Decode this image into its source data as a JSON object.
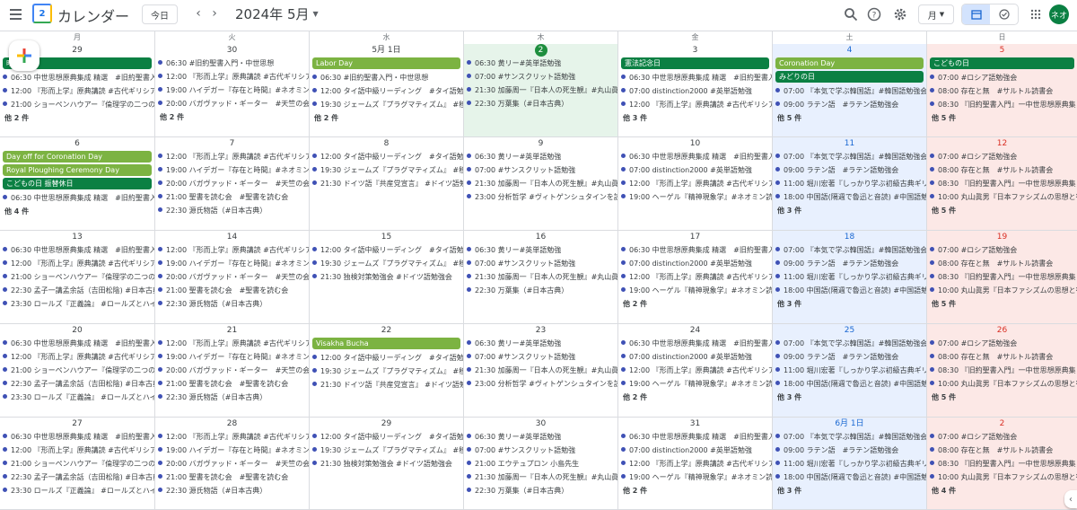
{
  "app": {
    "title": "カレンダー",
    "logo_num": "2"
  },
  "toolbar": {
    "today": "今日",
    "prev": "‹",
    "next": "›",
    "month_label": "2024年 5月",
    "view": "月",
    "avatar": "ネオ"
  },
  "colors": {
    "event_dot": "#3f51b5",
    "holiday_green": "#7cb342",
    "holiday_dark": "#0b8043",
    "today_bg": "#e6f4ea",
    "sat_bg": "#e8f0fe",
    "sun_bg": "#fce8e6"
  },
  "weekdays": [
    "月",
    "火",
    "水",
    "木",
    "金",
    "土",
    "日"
  ],
  "weeks": [
    [
      {
        "day": "29",
        "allday": [
          {
            "label": "昭和の日",
            "style": "dark"
          }
        ],
        "events": [
          "06:30 中世思想原典集成 精選　#旧約聖書入",
          "12:00 『形而上学』原典講読 #古代ギリシア",
          "21:00 ショーペンハウアー『倫理学の二つの"
        ],
        "more": "他 2 件"
      },
      {
        "day": "30",
        "allday": [],
        "events": [
          "06:30 #旧約聖書入門・中世思想",
          "12:00 『形而上学』原典講読 #古代ギリシア",
          "19:00 ハイデガー『存在と時間』#ネオミン",
          "20:00 バガヴァッド・ギーター　#天竺の会"
        ],
        "more": "他 2 件"
      },
      {
        "day": "5月 1日",
        "allday": [
          {
            "label": "Labor Day",
            "style": "green"
          }
        ],
        "events": [
          "06:30 #旧約聖書入門・中世思想",
          "12:00 タイ語中級リーディング　#タイ語勉",
          "19:30 ジェームズ『プラグマティズム』 #移"
        ],
        "more": "他 2 件"
      },
      {
        "day": "2",
        "today": true,
        "allday": [],
        "events": [
          "06:30 黄リー#英単語勉強",
          "07:00 #サンスクリット語勉強",
          "21:30 加藤周一『日本人の死生観』#丸山眞",
          "22:30 万葉集（#日本古典）"
        ],
        "more": ""
      },
      {
        "day": "3",
        "allday": [
          {
            "label": "憲法記念日",
            "style": "dark"
          }
        ],
        "events": [
          "06:30 中世思想原典集成 精選　#旧約聖書入",
          "07:00 distinction2000 #英単語勉強",
          "12:00 『形而上学』原典講読 #古代ギリシア"
        ],
        "more": "他 3 件"
      },
      {
        "day": "4",
        "allday": [
          {
            "label": "Coronation Day",
            "style": "green"
          },
          {
            "label": "みどりの日",
            "style": "dark"
          }
        ],
        "events": [
          "07:00 『本気で学ぶ韓国語』#韓国語勉強会",
          "09:00 ラテン語　#ラテン語勉強会"
        ],
        "more": "他 5 件"
      },
      {
        "day": "5",
        "allday": [
          {
            "label": "こどもの日",
            "style": "dark"
          }
        ],
        "events": [
          "07:00 #ロシア語勉強会",
          "08:00 存在と無　#サルトル読書会",
          "08:30 『旧約聖書入門』一中世思想原典集"
        ],
        "more": "他 5 件"
      }
    ],
    [
      {
        "day": "6",
        "allday": [
          {
            "label": "Day off for Coronation Day",
            "style": "green"
          },
          {
            "label": "Royal Ploughing Ceremony Day",
            "style": "green"
          },
          {
            "label": "こどもの日 振替休日",
            "style": "dark"
          }
        ],
        "events": [
          "06:30 中世思想原典集成 精選　#旧約聖書入"
        ],
        "more": "他 4 件"
      },
      {
        "day": "7",
        "allday": [],
        "events": [
          "12:00 『形而上学』原典講読 #古代ギリシア",
          "19:00 ハイデガー『存在と時間』#ネオミン",
          "20:00 バガヴァッド・ギーター　#天竺の会",
          "21:00 聖書を読む会　#聖書を読む会",
          "22:30 源氏物語（#日本古典）"
        ],
        "more": ""
      },
      {
        "day": "8",
        "allday": [],
        "events": [
          "12:00 タイ語中級リーディング　#タイ語勉",
          "19:30 ジェームズ『プラグマティズム』 #移",
          "21:30 ドイツ語『共産党宣言』 #ドイツ語勉"
        ],
        "more": ""
      },
      {
        "day": "9",
        "allday": [],
        "events": [
          "06:30 黄リー#英単語勉強",
          "07:00 #サンスクリット語勉強",
          "21:30 加藤周一『日本人の死生観』#丸山眞",
          "23:00 分析哲学 #ヴィトゲンシュタインを読"
        ],
        "more": ""
      },
      {
        "day": "10",
        "allday": [],
        "events": [
          "06:30 中世思想原典集成 精選　#旧約聖書入",
          "07:00 distinction2000 #英単語勉強",
          "12:00 『形而上学』原典講読 #古代ギリシア",
          "19:00 ヘーゲル『精神現象学』#ネオミン読"
        ],
        "more": ""
      },
      {
        "day": "11",
        "allday": [],
        "events": [
          "07:00 『本気で学ぶ韓国語』#韓国語勉強会",
          "09:00 ラテン語　#ラテン語勉強会",
          "11:00 堀川宏著『しっかり学ぶ初級古典ギリ",
          "18:00 中国語(隔週で魯迅と音読) #中国語勉"
        ],
        "more": "他 3 件"
      },
      {
        "day": "12",
        "allday": [],
        "events": [
          "07:00 #ロシア語勉強会",
          "08:00 存在と無　#サルトル読書会",
          "08:30 『旧約聖書入門』一中世思想原典集",
          "10:00 丸山眞男『日本ファシズムの思想と行"
        ],
        "more": "他 5 件"
      }
    ],
    [
      {
        "day": "13",
        "allday": [],
        "events": [
          "06:30 中世思想原典集成 精選　#旧約聖書入",
          "12:00 『形而上学』原典講読 #古代ギリシア",
          "21:00 ショーペンハウアー『倫理学の二つの",
          "22:30 孟子一講孟余話（吉田松陰) #日本古典",
          "23:30 ロールズ『正義論』 #ロールズとハイ"
        ],
        "more": ""
      },
      {
        "day": "14",
        "allday": [],
        "events": [
          "12:00 『形而上学』原典講読 #古代ギリシア",
          "19:00 ハイデガー『存在と時間』#ネオミン",
          "20:00 バガヴァッド・ギーター　#天竺の会",
          "21:00 聖書を読む会　#聖書を読む会",
          "22:30 源氏物語（#日本古典）"
        ],
        "more": ""
      },
      {
        "day": "15",
        "allday": [],
        "events": [
          "12:00 タイ語中級リーディング　#タイ語勉",
          "19:30 ジェームズ『プラグマティズム』 #移",
          "21:30 独検対策勉強会 #ドイツ語勉強会"
        ],
        "more": ""
      },
      {
        "day": "16",
        "allday": [],
        "events": [
          "06:30 黄リー#英単語勉強",
          "07:00 #サンスクリット語勉強",
          "21:30 加藤周一『日本人の死生観』#丸山眞",
          "22:30 万葉集（#日本古典）"
        ],
        "more": ""
      },
      {
        "day": "17",
        "allday": [],
        "events": [
          "06:30 中世思想原典集成 精選　#旧約聖書入",
          "07:00 distinction2000 #英単語勉強",
          "12:00 『形而上学』原典講読 #古代ギリシア",
          "19:00 ヘーゲル『精神現象学』#ネオミン読"
        ],
        "more": "他 2 件"
      },
      {
        "day": "18",
        "allday": [],
        "events": [
          "07:00 『本気で学ぶ韓国語』#韓国語勉強会",
          "09:00 ラテン語　#ラテン語勉強会",
          "11:00 堀川宏著『しっかり学ぶ初級古典ギリ",
          "18:00 中国語(隔週で魯迅と音読) #中国語勉"
        ],
        "more": "他 3 件"
      },
      {
        "day": "19",
        "allday": [],
        "events": [
          "07:00 #ロシア語勉強会",
          "08:00 存在と無　#サルトル読書会",
          "08:30 『旧約聖書入門』一中世思想原典集",
          "10:00 丸山眞男『日本ファシズムの思想と行"
        ],
        "more": "他 5 件"
      }
    ],
    [
      {
        "day": "20",
        "allday": [],
        "events": [
          "06:30 中世思想原典集成 精選　#旧約聖書入",
          "12:00 『形而上学』原典講読 #古代ギリシア",
          "21:00 ショーペンハウアー『倫理学の二つの",
          "22:30 孟子一講孟余話（吉田松陰) #日本古典",
          "23:30 ロールズ『正義論』 #ロールズとハイ"
        ],
        "more": ""
      },
      {
        "day": "21",
        "allday": [],
        "events": [
          "12:00 『形而上学』原典講読 #古代ギリシア",
          "19:00 ハイデガー『存在と時間』#ネオミン",
          "20:00 バガヴァッド・ギーター　#天竺の会",
          "21:00 聖書を読む会　#聖書を読む会",
          "22:30 源氏物語（#日本古典）"
        ],
        "more": ""
      },
      {
        "day": "22",
        "allday": [
          {
            "label": "Visakha Bucha",
            "style": "green"
          }
        ],
        "events": [
          "12:00 タイ語中級リーディング　#タイ語勉",
          "19:30 ジェームズ『プラグマティズム』 #移",
          "21:30 ドイツ語『共産党宣言』 #ドイツ語勉"
        ],
        "more": ""
      },
      {
        "day": "23",
        "allday": [],
        "events": [
          "06:30 黄リー#英単語勉強",
          "07:00 #サンスクリット語勉強",
          "21:30 加藤周一『日本人の死生観』#丸山眞",
          "23:00 分析哲学 #ヴィトゲンシュタインを読"
        ],
        "more": ""
      },
      {
        "day": "24",
        "allday": [],
        "events": [
          "06:30 中世思想原典集成 精選　#旧約聖書入",
          "07:00 distinction2000 #英単語勉強",
          "12:00 『形而上学』原典講読 #古代ギリシア",
          "19:00 ヘーゲル『精神現象学』#ネオミン読"
        ],
        "more": "他 2 件"
      },
      {
        "day": "25",
        "allday": [],
        "events": [
          "07:00 『本気で学ぶ韓国語』#韓国語勉強会",
          "09:00 ラテン語　#ラテン語勉強会",
          "11:00 堀川宏著『しっかり学ぶ初級古典ギリ",
          "18:00 中国語(隔週で魯迅と音読) #中国語勉"
        ],
        "more": "他 3 件"
      },
      {
        "day": "26",
        "allday": [],
        "events": [
          "07:00 #ロシア語勉強会",
          "08:00 存在と無　#サルトル読書会",
          "08:30 『旧約聖書入門』一中世思想原典集",
          "10:00 丸山眞男『日本ファシズムの思想と行"
        ],
        "more": "他 5 件"
      }
    ],
    [
      {
        "day": "27",
        "allday": [],
        "events": [
          "06:30 中世思想原典集成 精選　#旧約聖書入",
          "12:00 『形而上学』原典講読 #古代ギリシア",
          "21:00 ショーペンハウアー『倫理学の二つの",
          "22:30 孟子一講孟余話（吉田松陰) #日本古典",
          "23:30 ロールズ『正義論』 #ロールズとハイ"
        ],
        "more": ""
      },
      {
        "day": "28",
        "allday": [],
        "events": [
          "12:00 『形而上学』原典講読 #古代ギリシア",
          "19:00 ハイデガー『存在と時間』#ネオミン",
          "20:00 バガヴァッド・ギーター　#天竺の会",
          "21:00 聖書を読む会　#聖書を読む会",
          "22:30 源氏物語（#日本古典）"
        ],
        "more": ""
      },
      {
        "day": "29",
        "allday": [],
        "events": [
          "12:00 タイ語中級リーディング　#タイ語勉",
          "19:30 ジェームズ『プラグマティズム』 #移",
          "21:30 独検対策勉強会 #ドイツ語勉強会"
        ],
        "more": ""
      },
      {
        "day": "30",
        "allday": [],
        "events": [
          "06:30 黄リー#英単語勉強",
          "07:00 #サンスクリット語勉強",
          "21:00 エウテュプロン 小島先生",
          "21:30 加藤周一『日本人の死生観』#丸山眞",
          "22:30 万葉集（#日本古典）"
        ],
        "more": ""
      },
      {
        "day": "31",
        "allday": [],
        "events": [
          "06:30 中世思想原典集成 精選　#旧約聖書入",
          "07:00 distinction2000 #英単語勉強",
          "12:00 『形而上学』原典講読 #古代ギリシア",
          "19:00 ヘーゲル『精神現象学』#ネオミン読"
        ],
        "more": "他 2 件"
      },
      {
        "day": "6月 1日",
        "allday": [],
        "events": [
          "07:00 『本気で学ぶ韓国語』#韓国語勉強会",
          "09:00 ラテン語　#ラテン語勉強会",
          "11:00 堀川宏著『しっかり学ぶ初級古典ギリ",
          "18:00 中国語(隔週で魯迅と音読) #中国語勉"
        ],
        "more": "他 3 件"
      },
      {
        "day": "2",
        "allday": [],
        "events": [
          "07:00 #ロシア語勉強会",
          "08:00 存在と無　#サルトル読書会",
          "08:30 『旧約聖書入門』一中世思想原典集",
          "10:00 丸山眞男『日本ファシズムの思想と行"
        ],
        "more": "他 4 件"
      }
    ]
  ]
}
